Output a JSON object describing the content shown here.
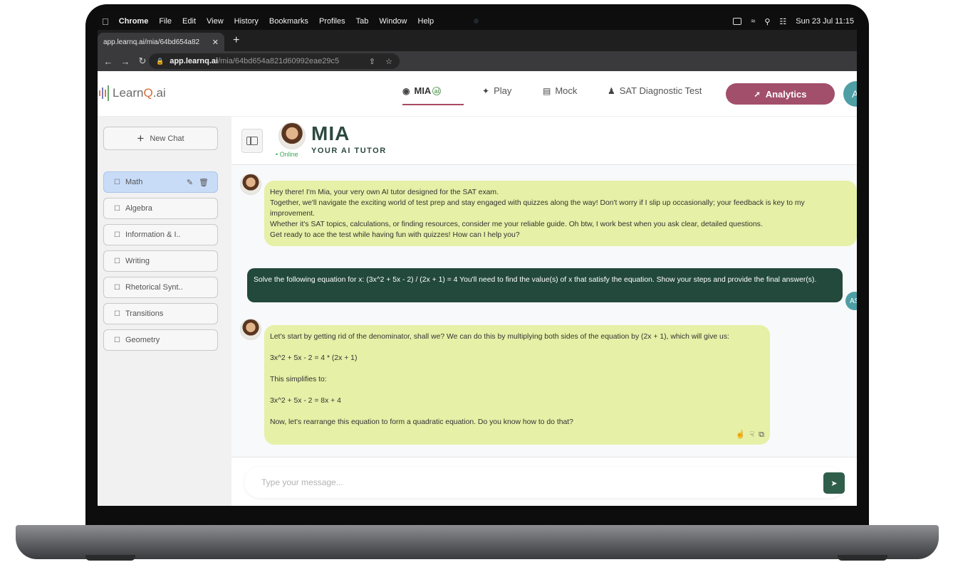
{
  "menubar": {
    "app": "Chrome",
    "items": [
      "File",
      "Edit",
      "View",
      "History",
      "Bookmarks",
      "Profiles",
      "Tab",
      "Window",
      "Help"
    ],
    "clock": "Sun 23 Jul  11:15"
  },
  "browser": {
    "tab_title": "app.learnq.ai/mia/64bd654a82",
    "url_host": "app.learnq.ai",
    "url_path": "/mia/64bd654a821d60992eae29c5"
  },
  "header": {
    "logo_prefix": "Learn",
    "logo_q": "Q",
    "logo_suffix": ".ai",
    "nav": {
      "mia": "MIA",
      "play": "Play",
      "mock": "Mock",
      "sat": "SAT Diagnostic Test",
      "analytics": "Analytics"
    },
    "avatar_initial": "A"
  },
  "sidebar": {
    "new_chat": "New Chat",
    "chats": [
      "Math",
      "Algebra",
      "Information & I..",
      "Writing",
      "Rhetorical Synt..",
      "Transitions",
      "Geometry"
    ]
  },
  "mia": {
    "name": "MIA",
    "subtitle": "YOUR AI TUTOR",
    "status": "• Online"
  },
  "messages": {
    "bot1": [
      "Hey there! I'm Mia, your very own AI tutor designed for the SAT exam.",
      "Together, we'll navigate the exciting world of test prep and stay engaged with quizzes along the way! Don't worry if I slip up occasionally; your feedback is key to my improvement.",
      "Whether it's SAT topics, calculations, or finding resources, consider me your reliable guide. Oh btw, I work best when you ask clear, detailed questions.",
      "Get ready to ace the test while having fun with quizzes! How can I help you?"
    ],
    "user1": "Solve the following equation for x: (3x^2 + 5x - 2) / (2x + 1) = 4 You'll need to find the value(s) of x that satisfy the equation. Show your steps and provide the final answer(s).",
    "user_avatar": "AS",
    "bot2": [
      "Let's start by getting rid of the denominator, shall we? We can do this by multiplying both sides of the equation by (2x + 1), which will give us:",
      "3x^2 + 5x - 2 = 4 * (2x + 1)",
      "This simplifies to:",
      "3x^2 + 5x - 2 = 8x + 4",
      "Now, let's rearrange this equation to form a quadratic equation. Do you know how to do that?"
    ]
  },
  "composer": {
    "placeholder": "Type your message..."
  }
}
